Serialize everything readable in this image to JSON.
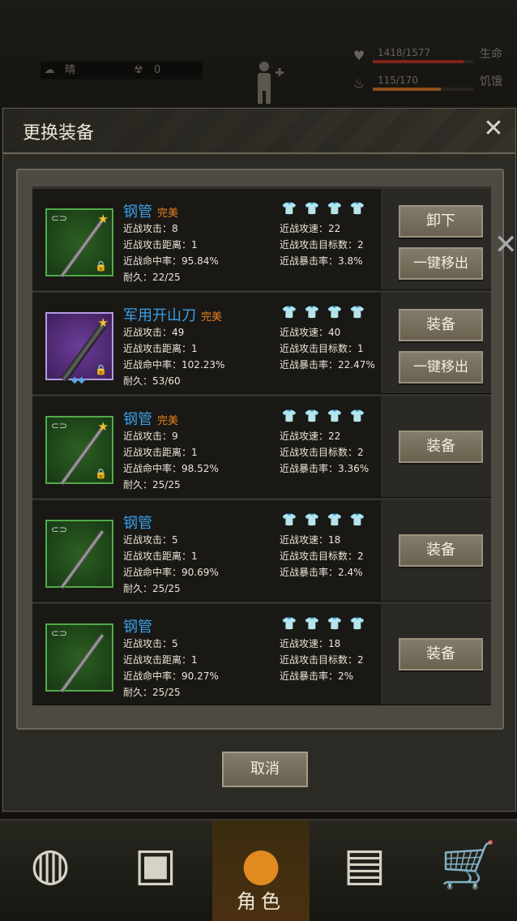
{
  "hud": {
    "weather": "晴",
    "radiation": "0",
    "health_value": "1418/1577",
    "health_label": "生命",
    "health_fraction": 0.9,
    "hunger_value": "115/170",
    "hunger_label": "饥饿",
    "hunger_fraction": 0.68
  },
  "modal": {
    "title": "更换装备",
    "close": "✕",
    "cancel": "取消"
  },
  "items": [
    {
      "name": "钢管",
      "quality": "完美",
      "attack": "近战攻击：8",
      "range": "近战攻击距离：1",
      "hit": "近战命中率：95.84%",
      "durability": "耐久：22/25",
      "speed": "近战攻速：22",
      "targets": "近战攻击目标数：2",
      "crit": "近战暴击率：3.8%",
      "buttons": [
        "卸下",
        "一键移出"
      ],
      "shirts_on": 1
    },
    {
      "name": "军用开山刀",
      "quality": "完美",
      "attack": "近战攻击：49",
      "range": "近战攻击距离：1",
      "hit": "近战命中率：102.23%",
      "durability": "耐久：53/60",
      "speed": "近战攻速：40",
      "targets": "近战攻击目标数：1",
      "crit": "近战暴击率：22.47%",
      "buttons": [
        "装备",
        "一键移出"
      ],
      "shirts_on": 3
    },
    {
      "name": "钢管",
      "quality": "完美",
      "attack": "近战攻击：9",
      "range": "近战攻击距离：1",
      "hit": "近战命中率：98.52%",
      "durability": "耐久：25/25",
      "speed": "近战攻速：22",
      "targets": "近战攻击目标数：2",
      "crit": "近战暴击率：3.36%",
      "buttons": [
        "装备"
      ],
      "shirts_on": 0
    },
    {
      "name": "钢管",
      "quality": "",
      "attack": "近战攻击：5",
      "range": "近战攻击距离：1",
      "hit": "近战命中率：90.69%",
      "durability": "耐久：25/25",
      "speed": "近战攻速：18",
      "targets": "近战攻击目标数：2",
      "crit": "近战暴击率：2.4%",
      "buttons": [
        "装备"
      ],
      "shirts_on": 0
    },
    {
      "name": "钢管",
      "quality": "",
      "attack": "近战攻击：5",
      "range": "近战攻击距离：1",
      "hit": "近战命中率：90.27%",
      "durability": "耐久：25/25",
      "speed": "近战攻速：18",
      "targets": "近战攻击目标数：2",
      "crit": "近战暴击率：2%",
      "buttons": [
        "装备"
      ],
      "shirts_on": 0
    }
  ],
  "nav": {
    "character_label": "角色"
  }
}
